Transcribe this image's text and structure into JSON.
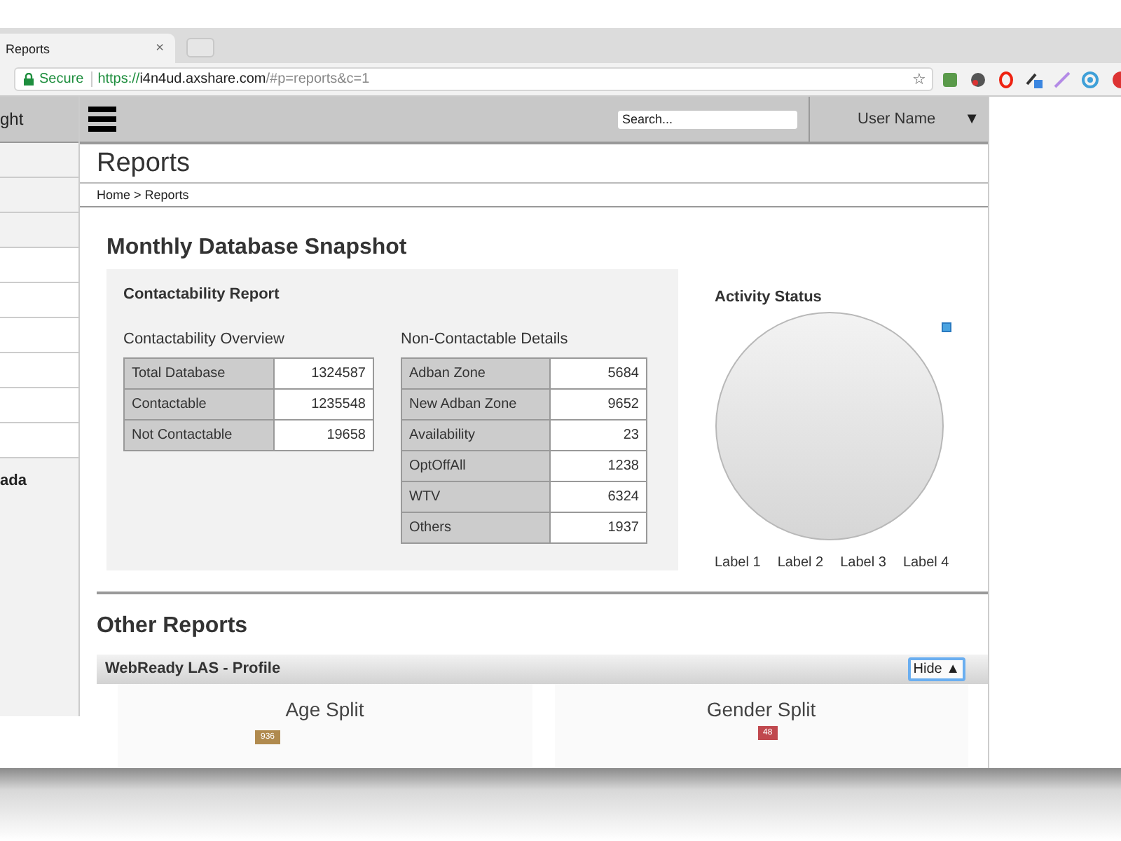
{
  "browser": {
    "tab": {
      "title": "Reports",
      "close": "×"
    },
    "address": {
      "secure_label": "Secure",
      "scheme": "https://",
      "host": "i4n4ud.axshare.com",
      "path": "/#p=reports&c=1",
      "bookmark": "☆"
    }
  },
  "sidebar": {
    "header": "ght",
    "items": [
      "ada"
    ]
  },
  "topbar": {
    "search": {
      "placeholder": "Search..."
    },
    "user": "User Name",
    "caret": "▼"
  },
  "page": {
    "title": "Reports",
    "breadcrumb": "Home > Reports"
  },
  "snapshot": {
    "heading": "Monthly Database Snapshot",
    "panel_title": "Contactability Report",
    "tables": [
      {
        "title": "Contactability Overview",
        "rows": [
          {
            "label": "Total Database",
            "value": "1324587"
          },
          {
            "label": "Contactable",
            "value": "1235548"
          },
          {
            "label": "Not Contactable",
            "value": "19658"
          }
        ]
      },
      {
        "title": "Non-Contactable Details",
        "rows": [
          {
            "label": "Adban Zone",
            "value": "5684"
          },
          {
            "label": "New Adban Zone",
            "value": "9652"
          },
          {
            "label": "Availability",
            "value": "23"
          },
          {
            "label": "OptOffAll",
            "value": "1238"
          },
          {
            "label": "WTV",
            "value": "6324"
          },
          {
            "label": "Others",
            "value": "1937"
          }
        ]
      }
    ],
    "activity": {
      "title": "Activity Status",
      "labels": [
        "Label 1",
        "Label 2",
        "Label 3",
        "Label 4"
      ]
    }
  },
  "other_reports": {
    "heading": "Other Reports",
    "section": {
      "title": "WebReady LAS - Profile",
      "button": "Hide ▲"
    },
    "cards": [
      {
        "title": "Age Split",
        "badge": {
          "text": "936",
          "color": "#b08a4e"
        }
      },
      {
        "title": "Gender Split",
        "badge": {
          "text": "48",
          "color": "#c0484e"
        }
      }
    ]
  }
}
